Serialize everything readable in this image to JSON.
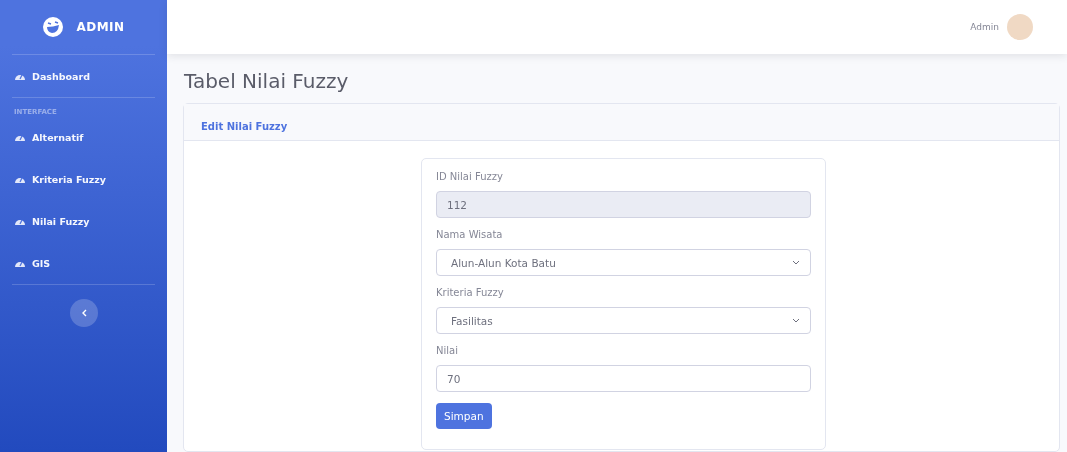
{
  "sidebar": {
    "brand": "ADMIN",
    "items": [
      {
        "label": "Dashboard"
      },
      {
        "heading": "INTERFACE"
      },
      {
        "label": "Alternatif"
      },
      {
        "label": "Kriteria Fuzzy"
      },
      {
        "label": "Nilai Fuzzy"
      },
      {
        "label": "GIS"
      }
    ]
  },
  "topbar": {
    "user": "Admin"
  },
  "page_title": "Tabel Nilai Fuzzy",
  "card": {
    "title": "Edit Nilai Fuzzy",
    "fields": [
      {
        "label": "ID Nilai Fuzzy",
        "kind": "readonly",
        "value": "112"
      },
      {
        "label": "Nama Wisata",
        "kind": "select",
        "value": "Alun-Alun Kota Batu"
      },
      {
        "label": "Kriteria Fuzzy",
        "kind": "select",
        "value": "Fasilitas"
      },
      {
        "label": "Nilai",
        "kind": "input",
        "value": "70"
      }
    ],
    "submit": "Simpan"
  }
}
